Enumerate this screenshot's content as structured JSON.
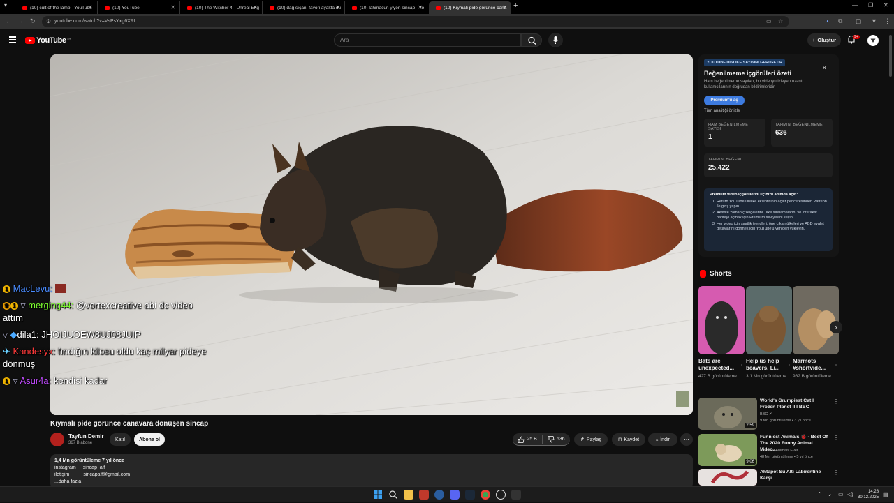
{
  "browser": {
    "tabs": [
      {
        "label": "(10) cult of the lamb - YouTube",
        "active": false
      },
      {
        "label": "(10) YouTube",
        "active": false
      },
      {
        "label": "(10) The Witcher 4 - Unreal Eng",
        "active": false
      },
      {
        "label": "(10) dağ sıçanı favori ayakta du",
        "active": false
      },
      {
        "label": "(10) lahmacun yiyen sincap - Yo",
        "active": false
      },
      {
        "label": "(10) Kıymalı pide görünce cana",
        "active": true
      }
    ],
    "url": "youtube.com/watch?v=VsPsYxg6XRI"
  },
  "header": {
    "logo_text": "YouTube",
    "logo_country": "TR",
    "search_placeholder": "Ara",
    "create_label": "Oluştur",
    "notif_count": "9+"
  },
  "video": {
    "title": "Kıymalı pide görünce canavara dönüşen sincap",
    "channel": "Tayfun Demir",
    "subscribers": "367 B abone",
    "join_label": "Katıl",
    "subscribe_label": "Abone ol",
    "likes": "25 B",
    "dislikes": "636",
    "share_label": "Paylaş",
    "save_label": "Kaydet",
    "download_label": "İndir"
  },
  "chat": [
    {
      "user": "MacLevu:",
      "text": ""
    },
    {
      "user": "merging44:",
      "text": "@vortexcreative abi dc video attım"
    },
    {
      "user": "dila1:",
      "text": "JHOIJUOEW8UJ08JUIP"
    },
    {
      "user": "Kandesyx:",
      "text": "fındığın kilosu oldu kaç milyar pideye dönmüş"
    },
    {
      "user": "Asur4a:",
      "text": "kendisi kadar"
    }
  ],
  "description": {
    "stats": "1,4 Mn görüntüleme  7 yıl önce",
    "line1_key": "instagram",
    "line1_val": "sincap_alf",
    "line2_key": "iletişim",
    "line2_val": "sincapalf@gmail.com",
    "more": "...daha fazla"
  },
  "dislike_panel": {
    "tag": "YOUTUBE DISLIKE SAYISINI GERI GETIR",
    "title": "Beğenilmeme içgörüleri özeti",
    "subtitle": "Ham beğenilmeme sayıları, bu videoyu izleyen uzantı kullanıcılarının doğrudan bildirimleridir.",
    "premium_button": "Premium'u aç",
    "all_analytics": "Tüm analitiği önizle",
    "raw_label": "HAM BEĞENILMEME SAYISI",
    "raw_value": "1",
    "est_dislike_label": "TAHMINI BEĞENILMEME",
    "est_dislike_value": "636",
    "est_like_label": "TAHMINI BEĞENI",
    "est_like_value": "25.422",
    "promo_title": "Premium video içgörülerini üç hızlı adımda açın:",
    "steps": [
      "Return YouTube Dislike eklentisinin açılır penceresinden Patreon ile giriş yapın.",
      "Aktivite zaman çizelgelerini, ülke sıralamalarını ve interaktif haritayı açmak için Premium seviyesini seçin.",
      "Her video için saatlik trendleri, öne çıkan ülkeleri ve ABD eyalet detaylarını görmek için YouTube'u yeniden yükleyin."
    ]
  },
  "shorts": {
    "heading": "Shorts",
    "items": [
      {
        "title": "Bats are unexpected...",
        "views": "427 B görüntüleme",
        "color": "#3b3b3b"
      },
      {
        "title": "Help us help beavers. Li...",
        "views": "3,1 Mn görüntüleme",
        "color": "#7a5633"
      },
      {
        "title": "Marmots #shortvide...",
        "views": "982 B görüntüleme",
        "color": "#b48f63"
      }
    ]
  },
  "recommendations": [
    {
      "title": "World's Grumpiest Cat I Frozen Planet II I BBC",
      "channel": "BBC",
      "meta": "9 Mn görüntüleme • 3 yıl önce",
      "duration": "2:59",
      "color": "#6b6a5a"
    },
    {
      "title": "Funniest Animals 🐞 - Best Of The 2020 Funny Animal Video...",
      "channel": "Funniest Animals Ever",
      "meta": "48 Mn görüntüleme • 5 yıl önce",
      "duration": "9:06",
      "color": "#8a8f63"
    },
    {
      "title": "Ahtapot Su Altı Labirentine Karşı",
      "channel": "",
      "meta": "",
      "duration": "",
      "color": "#b0303a"
    }
  ],
  "clock": {
    "time": "14:28",
    "date": "30.12.2025"
  }
}
